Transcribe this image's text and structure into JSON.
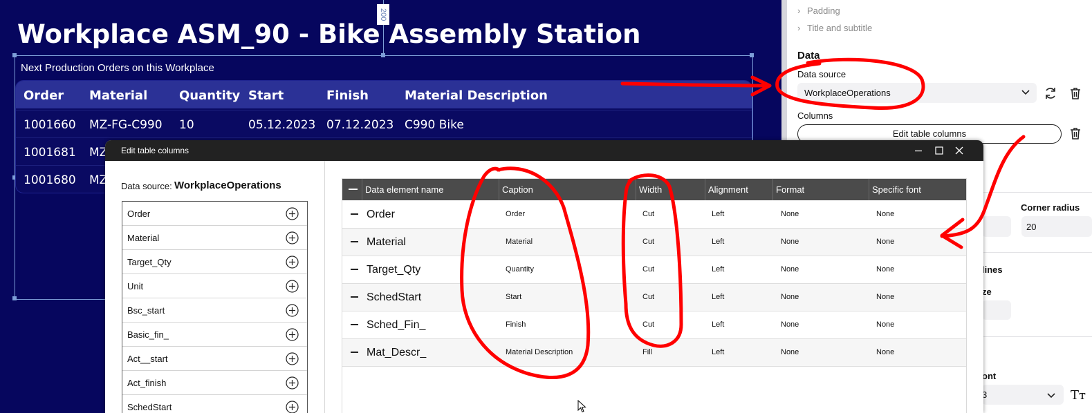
{
  "canvas": {
    "title": "Workplace  ASM_90 - Bike Assembly Station",
    "dimension_label": "200",
    "subtitle": "Next Production Orders on this Workplace",
    "table": {
      "headers": [
        "Order",
        "Material",
        "Quantity",
        "Start",
        "Finish",
        "Material Description"
      ],
      "rows": [
        [
          "1001660",
          "MZ-FG-C990",
          "10",
          "05.12.2023",
          "07.12.2023",
          "C990 Bike"
        ],
        [
          "1001681",
          "MZ"
        ],
        [
          "1001680",
          "MZ"
        ]
      ]
    }
  },
  "panel": {
    "accordions": [
      "Padding",
      "Title and subtitle"
    ],
    "data_heading": "Data",
    "data_source_label": "Data source",
    "data_source_value": "WorkplaceOperations",
    "columns_label": "Columns",
    "edit_columns_button": "Edit table columns",
    "corner_radius_label": "Corner radius",
    "corner_radius_value": "20",
    "lines_fragment": "lines",
    "size_fragment": "ze",
    "font_fragment": "ont",
    "font_value_fragment": "3",
    "text_size_icon": "Tт"
  },
  "dialog": {
    "title": "Edit table columns",
    "data_source_label": "Data source:",
    "data_source_name": "WorkplaceOperations",
    "fields": [
      "Order",
      "Material",
      "Target_Qty",
      "Unit",
      "Bsc_start",
      "Basic_fin_",
      "Act__start",
      "Act_finish",
      "SchedStart"
    ],
    "grid_headers": [
      "Data element name",
      "Caption",
      "Width",
      "Alignment",
      "Format",
      "Specific font"
    ],
    "rows": [
      {
        "name": "Order",
        "caption": "Order",
        "width": "Cut",
        "alignment": "Left",
        "format": "None",
        "font": "None"
      },
      {
        "name": "Material",
        "caption": "Material",
        "width": "Cut",
        "alignment": "Left",
        "format": "None",
        "font": "None"
      },
      {
        "name": "Target_Qty",
        "caption": "Quantity",
        "width": "Cut",
        "alignment": "Left",
        "format": "None",
        "font": "None"
      },
      {
        "name": "SchedStart",
        "caption": "Start",
        "width": "Cut",
        "alignment": "Left",
        "format": "None",
        "font": "None"
      },
      {
        "name": "Sched_Fin_",
        "caption": "Finish",
        "width": "Cut",
        "alignment": "Left",
        "format": "None",
        "font": "None"
      },
      {
        "name": "Mat_Descr_",
        "caption": "Material Description",
        "width": "Fill",
        "alignment": "Left",
        "format": "None",
        "font": "None"
      }
    ]
  },
  "colors": {
    "canvas_bg": "#06065e",
    "table_header_bg": "#2b3196",
    "grid_header_bg": "#4b4b4b",
    "annotation_red": "#ff0000"
  }
}
